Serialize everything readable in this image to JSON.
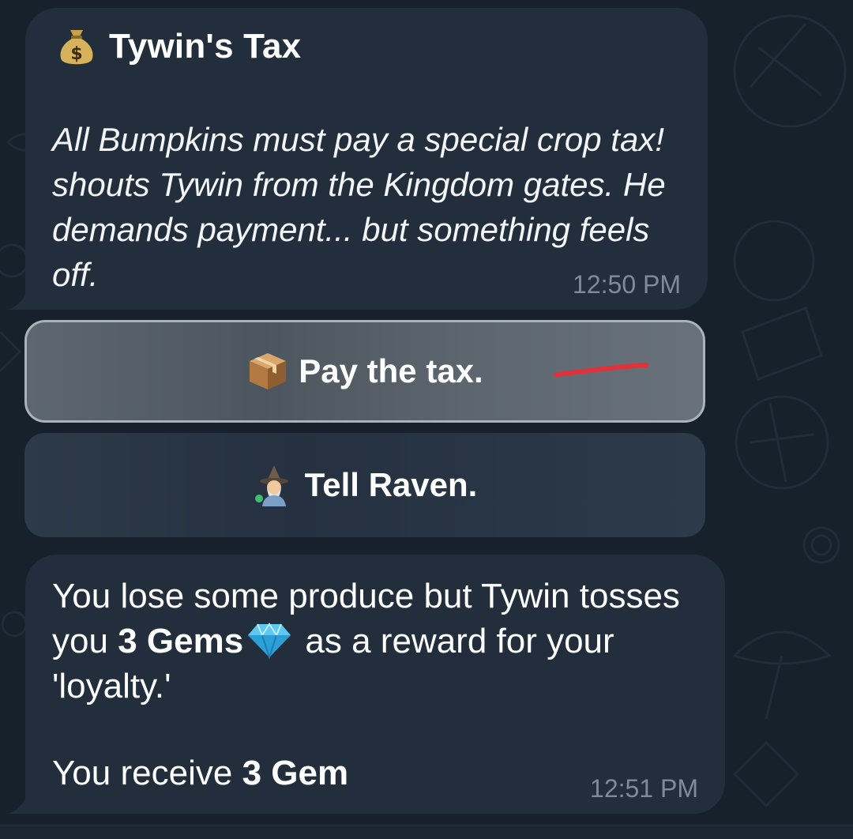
{
  "messages": [
    {
      "title": "Tywin's Tax",
      "title_icon": "money-bag-icon",
      "body": "All Bumpkins must pay a special crop tax! shouts Tywin from the Kingdom gates. He demands payment... but something feels off.",
      "time": "12:50 PM"
    },
    {
      "result_part1": "You lose some produce but Tywin tosses you",
      "result_bold1": "3 Gems",
      "result_icon": "gem-icon",
      "result_part2": "as a reward for your 'loyalty.'",
      "receive_text": "You receive",
      "receive_bold": "3 Gem",
      "time": "12:51 PM"
    }
  ],
  "keyboard": {
    "buttons": [
      {
        "label": "Pay the tax.",
        "icon": "package-icon",
        "selected": true
      },
      {
        "label": "Tell Raven.",
        "icon": "mage-icon",
        "selected": false
      }
    ]
  },
  "colors": {
    "background": "#17212b",
    "bubble": "#232e3c",
    "time": "#7f8b98",
    "annotation": "#e0323a"
  }
}
